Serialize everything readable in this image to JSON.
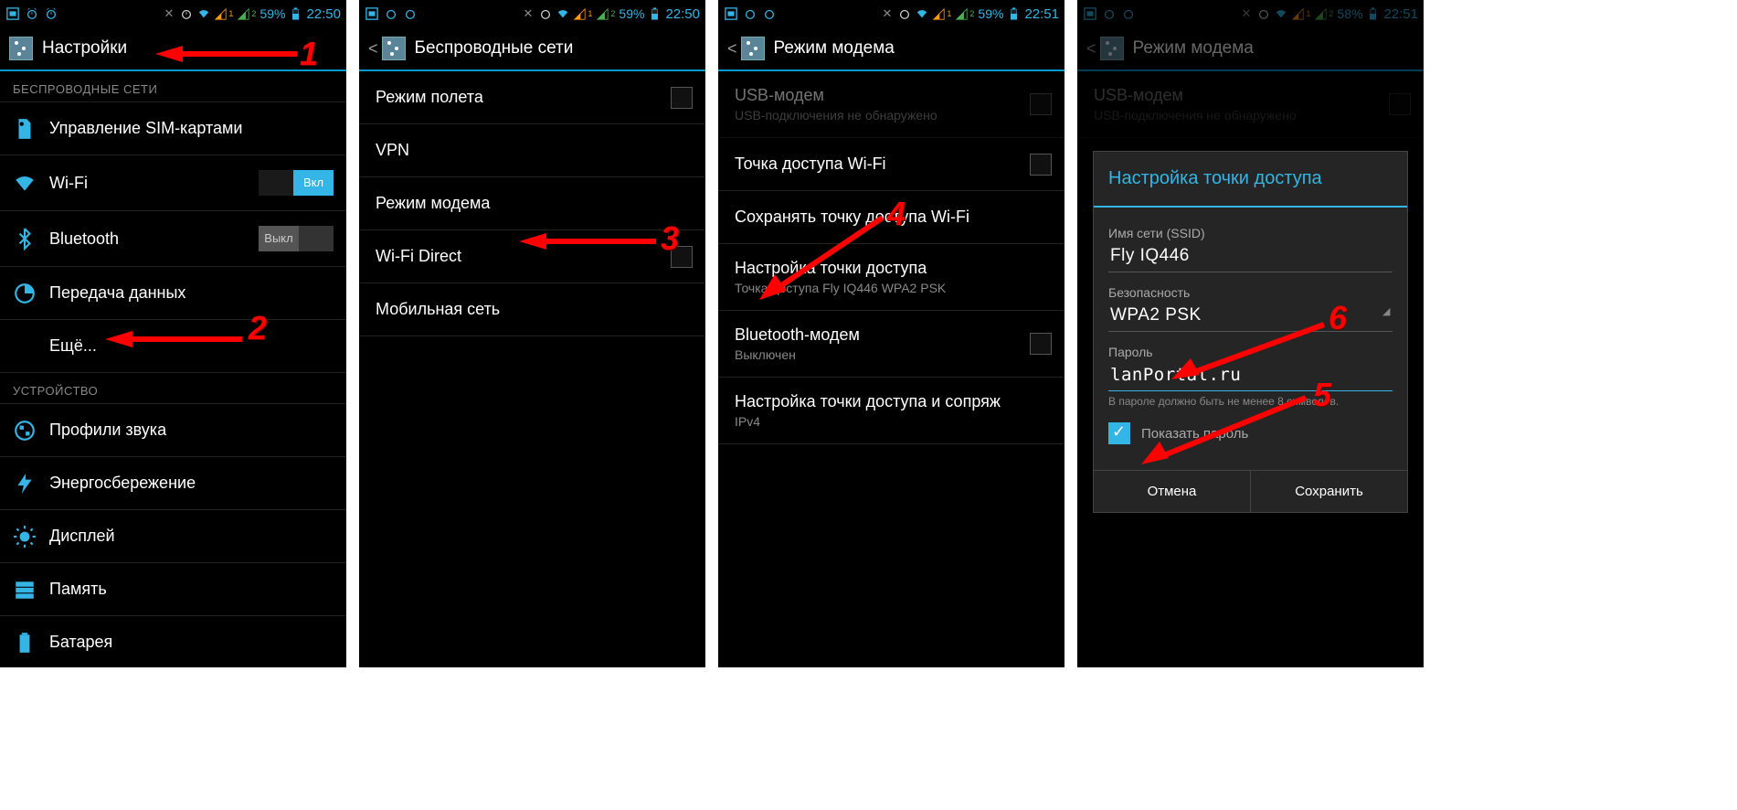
{
  "statusbar": {
    "battery": "59%",
    "time_a": "22:50",
    "time_b": "22:51",
    "battery_b": "58%"
  },
  "screen1": {
    "title": "Настройки",
    "section_wireless": "БЕСПРОВОДНЫЕ СЕТИ",
    "section_device": "УСТРОЙСТВО",
    "items": {
      "sim": "Управление SIM-картами",
      "wifi": "Wi-Fi",
      "wifi_toggle": "Вкл",
      "bt": "Bluetooth",
      "bt_toggle": "Выкл",
      "data": "Передача данных",
      "more": "Ещё...",
      "profiles": "Профили звука",
      "power": "Энергосбережение",
      "display": "Дисплей",
      "storage": "Память",
      "battery": "Батарея"
    }
  },
  "screen2": {
    "title": "Беспроводные сети",
    "items": {
      "airplane": "Режим полета",
      "vpn": "VPN",
      "tether": "Режим модема",
      "wifidirect": "Wi-Fi Direct",
      "mobile": "Мобильная сеть"
    }
  },
  "screen3": {
    "title": "Режим модема",
    "items": {
      "usb": "USB-модем",
      "usb_sub": "USB-подключения не обнаружено",
      "hotspot": "Точка доступа Wi-Fi",
      "keep": "Сохранять точку доступа Wi-Fi",
      "setup": "Настройка точки доступа",
      "setup_sub": "Точка доступа Fly IQ446 WPA2 PSK",
      "btmodem": "Bluetooth-модем",
      "btmodem_sub": "Выключен",
      "pairing": "Настройка точки доступа и сопряж",
      "pairing_sub": "IPv4"
    }
  },
  "screen4": {
    "title": "Режим модема",
    "bg_usb": "USB-модем",
    "bg_usb_sub": "USB-подключения не обнаружено",
    "dialog": {
      "title": "Настройка точки доступа",
      "ssid_label": "Имя сети (SSID)",
      "ssid_value": "Fly IQ446",
      "security_label": "Безопасность",
      "security_value": "WPA2 PSK",
      "password_label": "Пароль",
      "password_value": "lanPortal.ru",
      "hint": "В пароле должно быть не менее 8 символов.",
      "show_pw": "Показать пароль",
      "cancel": "Отмена",
      "save": "Сохранить"
    }
  },
  "annotations": {
    "n1": "1",
    "n2": "2",
    "n3": "3",
    "n4": "4",
    "n5": "5",
    "n6": "6"
  }
}
